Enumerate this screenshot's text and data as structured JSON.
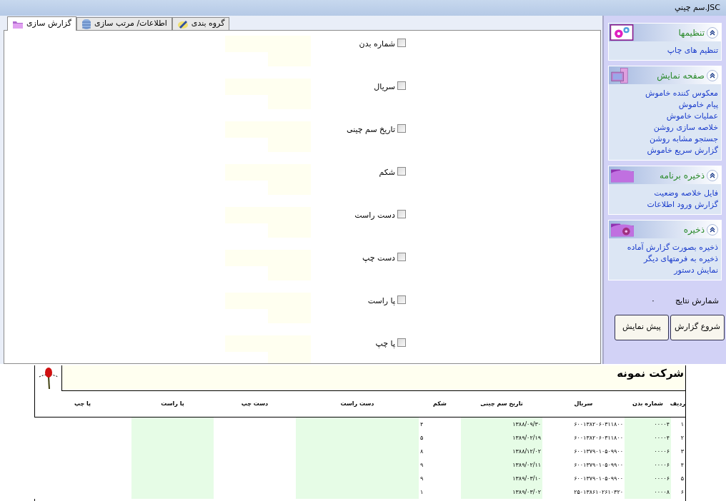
{
  "window": {
    "title": "JSC.سم چيني"
  },
  "tabs": [
    {
      "label": "گروه بندی",
      "selected": false
    },
    {
      "label": "اطلاعات/ مرتب سازی",
      "selected": false
    },
    {
      "label": "گزارش سازی",
      "selected": true
    }
  ],
  "fields": [
    {
      "label": "شماره بدن",
      "checked": false
    },
    {
      "label": "سریال",
      "checked": false
    },
    {
      "label": "تاریخ سم چینی",
      "checked": false
    },
    {
      "label": "شکم",
      "checked": false
    },
    {
      "label": "دست راست",
      "checked": false
    },
    {
      "label": "دست چپ",
      "checked": false
    },
    {
      "label": "پا راست",
      "checked": false
    },
    {
      "label": "پا چپ",
      "checked": false
    }
  ],
  "sidebar": {
    "panels": [
      {
        "title": "تنظیمها",
        "expanded": true,
        "items": [
          "تنظیم های چاپ"
        ]
      },
      {
        "title": "صفحه نمایش",
        "expanded": true,
        "items": [
          "معکوس کننده خاموش",
          "پیام خاموش",
          "عملیات خاموش",
          "خلاصه سازی روشن",
          "جستجو مشابه روشن",
          "گزارش سریع خاموش"
        ]
      },
      {
        "title": "ذخیره برنامه",
        "expanded": true,
        "items": [
          "فایل خلاصه وضعیت",
          "گزارش ورود اطلاعات"
        ]
      },
      {
        "title": "ذخیره",
        "expanded": true,
        "items": [
          "ذخیره بصورت گزارش آماده",
          "ذخیره به فرمتهای دیگر",
          "نمایش دستور"
        ]
      }
    ],
    "results_label": "شمارش نتایج",
    "results_value": "۰",
    "buttons": [
      "شروع گزارش",
      "پیش نمایش"
    ]
  },
  "report": {
    "title": "شرکت نمونه",
    "columns": [
      "ردیف",
      "شماره بدن",
      "سریال",
      "تاریخ سم چینی",
      "شکم",
      "دست راست",
      "دست چپ",
      "پا راست",
      "پا چپ"
    ],
    "rows": [
      [
        "۱",
        "۰۰۰۰۴",
        "۶۰۰۱۳۸۲۰۶۰۳۱۱۸۰۰",
        "۱۳۸۸/۰۹/۳۰",
        "۴"
      ],
      [
        "۲",
        "۰۰۰۰۴",
        "۶۰۰۱۳۸۲۰۶۰۳۱۱۸۰۰",
        "۱۳۸۹/۰۲/۱۹",
        "۵"
      ],
      [
        "۳",
        "۰۰۰۰۶",
        "۶۰۰۱۳۷۹۰۱۰۵۰۹۹۰۰",
        "۱۳۸۸/۱۲/۰۲",
        "۸"
      ],
      [
        "۴",
        "۰۰۰۰۶",
        "۶۰۰۱۳۷۹۰۱۰۵۰۹۹۰۰",
        "۱۳۸۹/۰۲/۱۱",
        "۹"
      ],
      [
        "۵",
        "۰۰۰۰۶",
        "۶۰۰۱۳۷۹۰۱۰۵۰۹۹۰۰",
        "۱۳۸۹/۰۳/۱۰",
        "۹"
      ],
      [
        "۶",
        "۰۰۰۰۸",
        "۲۵۰۱۳۸۶۱۰۲۶۱۰۳۲۰",
        "۱۳۸۹/۰۳/۰۲",
        "۱"
      ]
    ]
  }
}
